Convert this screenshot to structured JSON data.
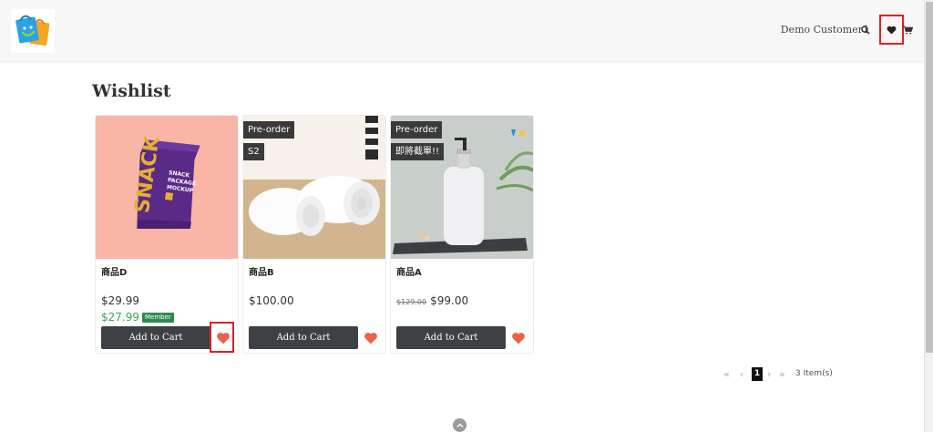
{
  "header": {
    "customer_name": "Demo Customer1",
    "icons": [
      "search-icon",
      "heart-icon",
      "cart-icon"
    ]
  },
  "page": {
    "title": "Wishlist"
  },
  "products": [
    {
      "name": "商品D",
      "price": "$29.99",
      "member_price": "$27.99",
      "member_label": "Member",
      "badges": [],
      "add_to_cart": "Add to Cart"
    },
    {
      "name": "商品B",
      "price": "$100.00",
      "badges": [
        "Pre-order",
        "S2"
      ],
      "add_to_cart": "Add to Cart"
    },
    {
      "name": "商品A",
      "original_price": "$129.00",
      "price": "$99.00",
      "badges": [
        "Pre-order",
        "即將截單!!"
      ],
      "add_to_cart": "Add to Cart"
    }
  ],
  "pagination": {
    "current_page": "1",
    "items_count": "3 Item(s)"
  },
  "colors": {
    "heart": "#f0604d",
    "button": "#3d4044",
    "member_green": "#3aa35b",
    "highlight": "#e02020"
  }
}
